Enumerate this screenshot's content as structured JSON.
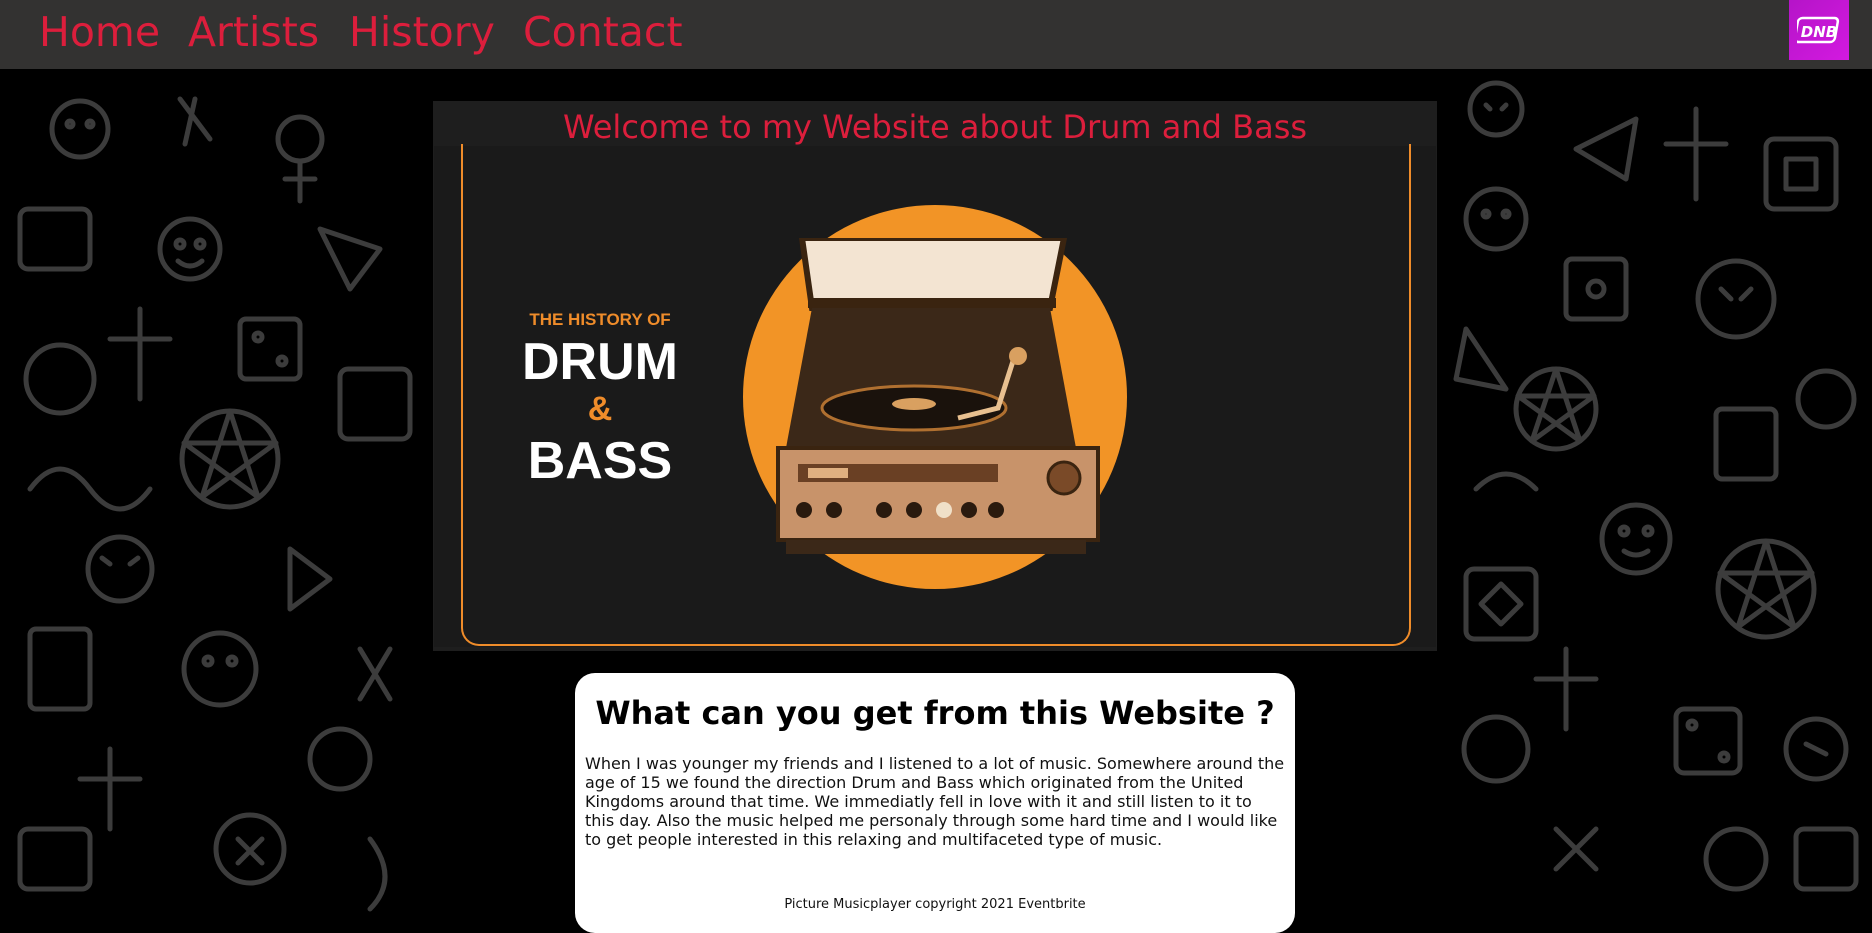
{
  "nav": {
    "items": [
      {
        "label": "Home"
      },
      {
        "label": "Artists"
      },
      {
        "label": "History"
      },
      {
        "label": "Contact"
      }
    ],
    "logo_text": "DNB"
  },
  "banner": {
    "title": "Welcome to my Website about Drum and Bass"
  },
  "hero_image": {
    "subtitle": "THE HISTORY OF",
    "line1": "DRUM",
    "line2": "&",
    "line3": "BASS",
    "circle_color": "#f29426",
    "accent_color": "#ef8c2a"
  },
  "card": {
    "heading": "What can you get from this Website ?",
    "text": "When I was younger my friends and I listened to a lot of music. Somewhere around the age of 15 we found the direction Drum and Bass which originated from the United Kingdoms around that time. We immediatly fell in love with it and still listen to it to this day. Also the music helped me personaly through some hard time and I would like to get people interested in this relaxing and multifaceted type of music.",
    "credit": "Picture Musicplayer copyright 2021 Eventbrite"
  },
  "colors": {
    "nav_bg": "#333231",
    "nav_link": "#dc1e3c",
    "logo_bg": "#c417d4",
    "page_bg": "#000000"
  }
}
